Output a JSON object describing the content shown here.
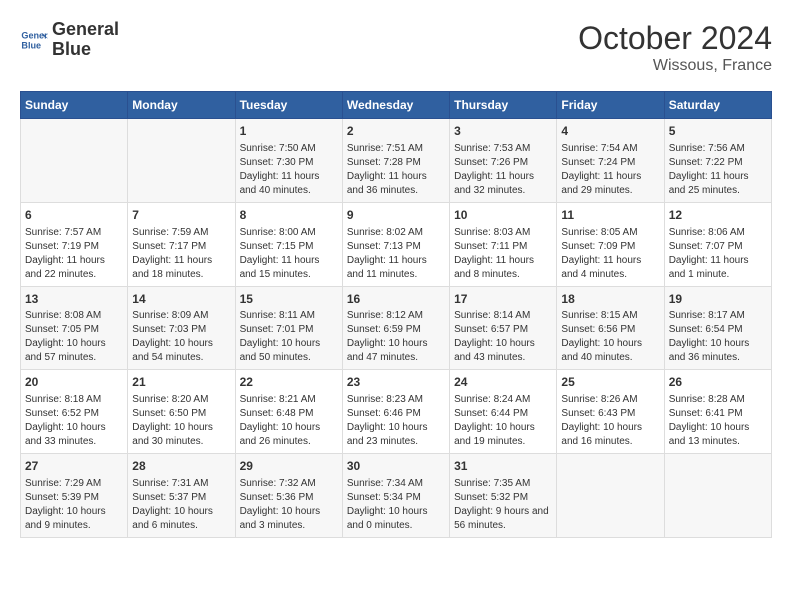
{
  "header": {
    "logo_line1": "General",
    "logo_line2": "Blue",
    "month": "October 2024",
    "location": "Wissous, France"
  },
  "weekdays": [
    "Sunday",
    "Monday",
    "Tuesday",
    "Wednesday",
    "Thursday",
    "Friday",
    "Saturday"
  ],
  "weeks": [
    [
      {
        "day": "",
        "info": ""
      },
      {
        "day": "",
        "info": ""
      },
      {
        "day": "1",
        "info": "Sunrise: 7:50 AM\nSunset: 7:30 PM\nDaylight: 11 hours and 40 minutes."
      },
      {
        "day": "2",
        "info": "Sunrise: 7:51 AM\nSunset: 7:28 PM\nDaylight: 11 hours and 36 minutes."
      },
      {
        "day": "3",
        "info": "Sunrise: 7:53 AM\nSunset: 7:26 PM\nDaylight: 11 hours and 32 minutes."
      },
      {
        "day": "4",
        "info": "Sunrise: 7:54 AM\nSunset: 7:24 PM\nDaylight: 11 hours and 29 minutes."
      },
      {
        "day": "5",
        "info": "Sunrise: 7:56 AM\nSunset: 7:22 PM\nDaylight: 11 hours and 25 minutes."
      }
    ],
    [
      {
        "day": "6",
        "info": "Sunrise: 7:57 AM\nSunset: 7:19 PM\nDaylight: 11 hours and 22 minutes."
      },
      {
        "day": "7",
        "info": "Sunrise: 7:59 AM\nSunset: 7:17 PM\nDaylight: 11 hours and 18 minutes."
      },
      {
        "day": "8",
        "info": "Sunrise: 8:00 AM\nSunset: 7:15 PM\nDaylight: 11 hours and 15 minutes."
      },
      {
        "day": "9",
        "info": "Sunrise: 8:02 AM\nSunset: 7:13 PM\nDaylight: 11 hours and 11 minutes."
      },
      {
        "day": "10",
        "info": "Sunrise: 8:03 AM\nSunset: 7:11 PM\nDaylight: 11 hours and 8 minutes."
      },
      {
        "day": "11",
        "info": "Sunrise: 8:05 AM\nSunset: 7:09 PM\nDaylight: 11 hours and 4 minutes."
      },
      {
        "day": "12",
        "info": "Sunrise: 8:06 AM\nSunset: 7:07 PM\nDaylight: 11 hours and 1 minute."
      }
    ],
    [
      {
        "day": "13",
        "info": "Sunrise: 8:08 AM\nSunset: 7:05 PM\nDaylight: 10 hours and 57 minutes."
      },
      {
        "day": "14",
        "info": "Sunrise: 8:09 AM\nSunset: 7:03 PM\nDaylight: 10 hours and 54 minutes."
      },
      {
        "day": "15",
        "info": "Sunrise: 8:11 AM\nSunset: 7:01 PM\nDaylight: 10 hours and 50 minutes."
      },
      {
        "day": "16",
        "info": "Sunrise: 8:12 AM\nSunset: 6:59 PM\nDaylight: 10 hours and 47 minutes."
      },
      {
        "day": "17",
        "info": "Sunrise: 8:14 AM\nSunset: 6:57 PM\nDaylight: 10 hours and 43 minutes."
      },
      {
        "day": "18",
        "info": "Sunrise: 8:15 AM\nSunset: 6:56 PM\nDaylight: 10 hours and 40 minutes."
      },
      {
        "day": "19",
        "info": "Sunrise: 8:17 AM\nSunset: 6:54 PM\nDaylight: 10 hours and 36 minutes."
      }
    ],
    [
      {
        "day": "20",
        "info": "Sunrise: 8:18 AM\nSunset: 6:52 PM\nDaylight: 10 hours and 33 minutes."
      },
      {
        "day": "21",
        "info": "Sunrise: 8:20 AM\nSunset: 6:50 PM\nDaylight: 10 hours and 30 minutes."
      },
      {
        "day": "22",
        "info": "Sunrise: 8:21 AM\nSunset: 6:48 PM\nDaylight: 10 hours and 26 minutes."
      },
      {
        "day": "23",
        "info": "Sunrise: 8:23 AM\nSunset: 6:46 PM\nDaylight: 10 hours and 23 minutes."
      },
      {
        "day": "24",
        "info": "Sunrise: 8:24 AM\nSunset: 6:44 PM\nDaylight: 10 hours and 19 minutes."
      },
      {
        "day": "25",
        "info": "Sunrise: 8:26 AM\nSunset: 6:43 PM\nDaylight: 10 hours and 16 minutes."
      },
      {
        "day": "26",
        "info": "Sunrise: 8:28 AM\nSunset: 6:41 PM\nDaylight: 10 hours and 13 minutes."
      }
    ],
    [
      {
        "day": "27",
        "info": "Sunrise: 7:29 AM\nSunset: 5:39 PM\nDaylight: 10 hours and 9 minutes."
      },
      {
        "day": "28",
        "info": "Sunrise: 7:31 AM\nSunset: 5:37 PM\nDaylight: 10 hours and 6 minutes."
      },
      {
        "day": "29",
        "info": "Sunrise: 7:32 AM\nSunset: 5:36 PM\nDaylight: 10 hours and 3 minutes."
      },
      {
        "day": "30",
        "info": "Sunrise: 7:34 AM\nSunset: 5:34 PM\nDaylight: 10 hours and 0 minutes."
      },
      {
        "day": "31",
        "info": "Sunrise: 7:35 AM\nSunset: 5:32 PM\nDaylight: 9 hours and 56 minutes."
      },
      {
        "day": "",
        "info": ""
      },
      {
        "day": "",
        "info": ""
      }
    ]
  ]
}
